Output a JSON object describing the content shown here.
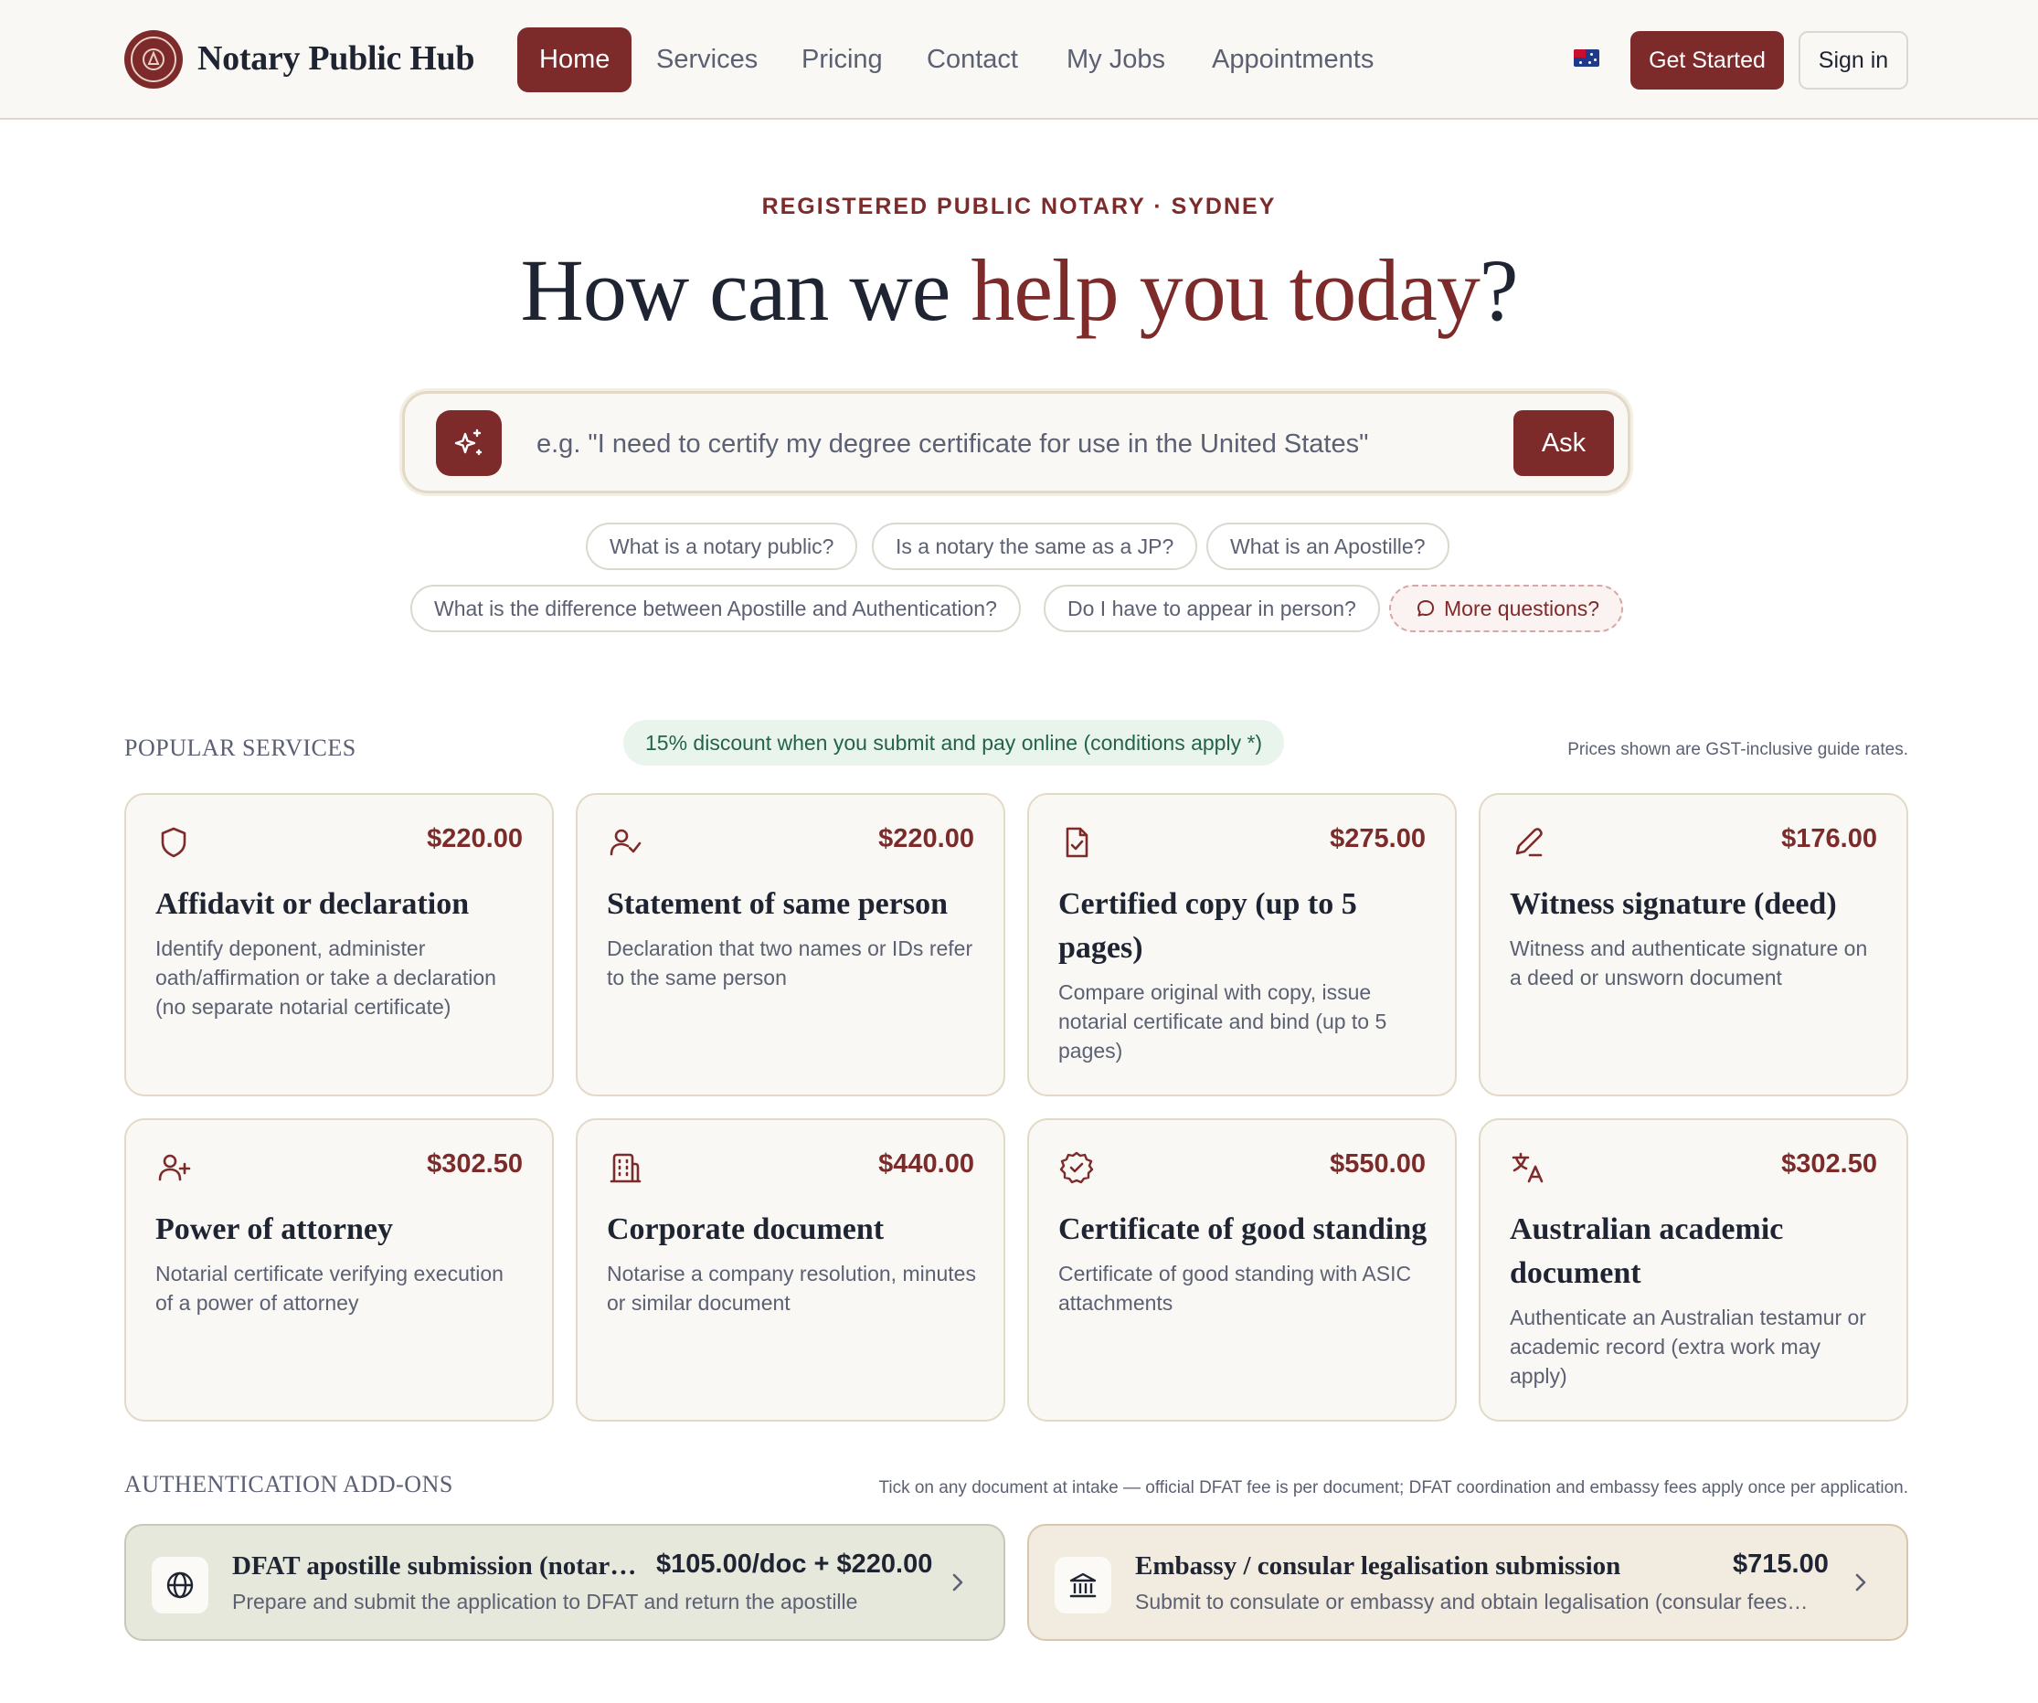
{
  "header": {
    "brand": "Notary Public Hub",
    "nav": [
      "Home",
      "Services",
      "Pricing",
      "Contact",
      "My Jobs",
      "Appointments"
    ],
    "active_nav": "Home",
    "get_started": "Get Started",
    "sign_in": "Sign in"
  },
  "hero": {
    "eyebrow": "REGISTERED PUBLIC NOTARY · SYDNEY",
    "title_part1": "How can we ",
    "title_accent": "help you today",
    "title_end": "?",
    "search_placeholder": "e.g. \"I need to certify my degree certificate for use in the United States\"",
    "ask": "Ask"
  },
  "quick_questions": [
    "What is a notary public?",
    "Is a notary the same as a JP?",
    "What is an Apostille?",
    "What is the difference between Apostille and Authentication?",
    "Do I have to appear in person?",
    "More questions?"
  ],
  "popular": {
    "title": "POPULAR SERVICES",
    "promo": "15% discount when you submit and pay online (conditions apply *)",
    "note": "Prices shown are GST-inclusive guide rates.",
    "cards": [
      {
        "icon": "shield-icon",
        "price": "$220.00",
        "title": "Affidavit or declaration",
        "desc": "Identify deponent, administer oath/affirmation or take a declaration (no separate notarial certificate)"
      },
      {
        "icon": "user-check-icon",
        "price": "$220.00",
        "title": "Statement of same person",
        "desc": "Declaration that two names or IDs refer to the same person"
      },
      {
        "icon": "file-check-icon",
        "price": "$275.00",
        "title": "Certified copy (up to 5 pages)",
        "desc": "Compare original with copy, issue notarial certificate and bind (up to 5 pages)"
      },
      {
        "icon": "pen-icon",
        "price": "$176.00",
        "title": "Witness signature (deed)",
        "desc": "Witness and authenticate signature on a deed or unsworn document"
      },
      {
        "icon": "user-plus-icon",
        "price": "$302.50",
        "title": "Power of attorney",
        "desc": "Notarial certificate verifying execution of a power of attorney"
      },
      {
        "icon": "building-icon",
        "price": "$440.00",
        "title": "Corporate document",
        "desc": "Notarise a company resolution, minutes or similar document"
      },
      {
        "icon": "badge-check-icon",
        "price": "$550.00",
        "title": "Certificate of good standing",
        "desc": "Certificate of good standing with ASIC attachments"
      },
      {
        "icon": "languages-icon",
        "price": "$302.50",
        "title": "Australian academic document",
        "desc": "Authenticate an Australian testamur or academic record (extra work may apply)"
      }
    ]
  },
  "addons": {
    "title": "AUTHENTICATION ADD-ONS",
    "note": "Tick on any document at intake — official DFAT fee is per document; DFAT coordination and embassy fees apply once per application.",
    "items": [
      {
        "icon": "globe-icon",
        "name": "DFAT apostille submission (notarial)",
        "price": "$105.00/doc + $220.00",
        "desc": "Prepare and submit the application to DFAT and return the apostille",
        "color": "#e6e8dc"
      },
      {
        "icon": "landmark-icon",
        "name": "Embassy / consular legalisation submission",
        "price": "$715.00",
        "desc": "Submit to consulate or embassy and obtain legalisation (consular fees apply)",
        "color": "#f2ebdf"
      }
    ]
  },
  "colors": {
    "brand": "#7d2a2a",
    "text": "#1f2433",
    "muted": "#5b6072",
    "promo_bg": "#e9f4ec"
  }
}
